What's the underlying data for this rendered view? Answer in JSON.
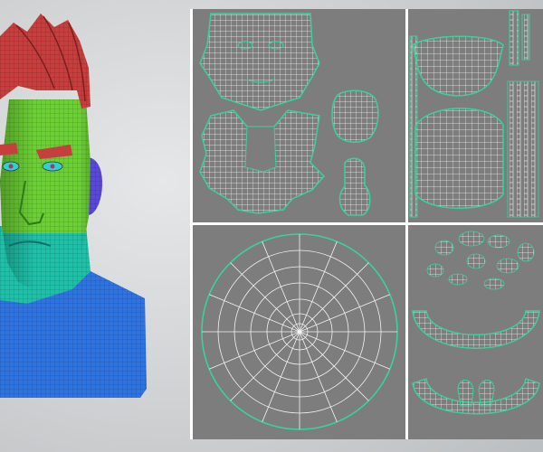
{
  "scene": {
    "model": {
      "colors": {
        "hair": "#c63e3e",
        "skin_upper": "#6ccf35",
        "skin_lower": "#1fbfa8",
        "neck": "#2f73e0",
        "ear": "#5a48d6",
        "eyebrow": "#c63e3e",
        "eye": "#2fd0d0"
      }
    },
    "uv_panels": [
      {
        "id": "face_and_neck_shells"
      },
      {
        "id": "hair_shells"
      },
      {
        "id": "circular_cap_shell"
      },
      {
        "id": "teeth_and_mouth_shells"
      }
    ],
    "colors": {
      "panel_background": "#7d7d7d",
      "separator": "#ffffff",
      "uv_wire": "#f2f2f2",
      "uv_border": "#39d39a"
    }
  }
}
